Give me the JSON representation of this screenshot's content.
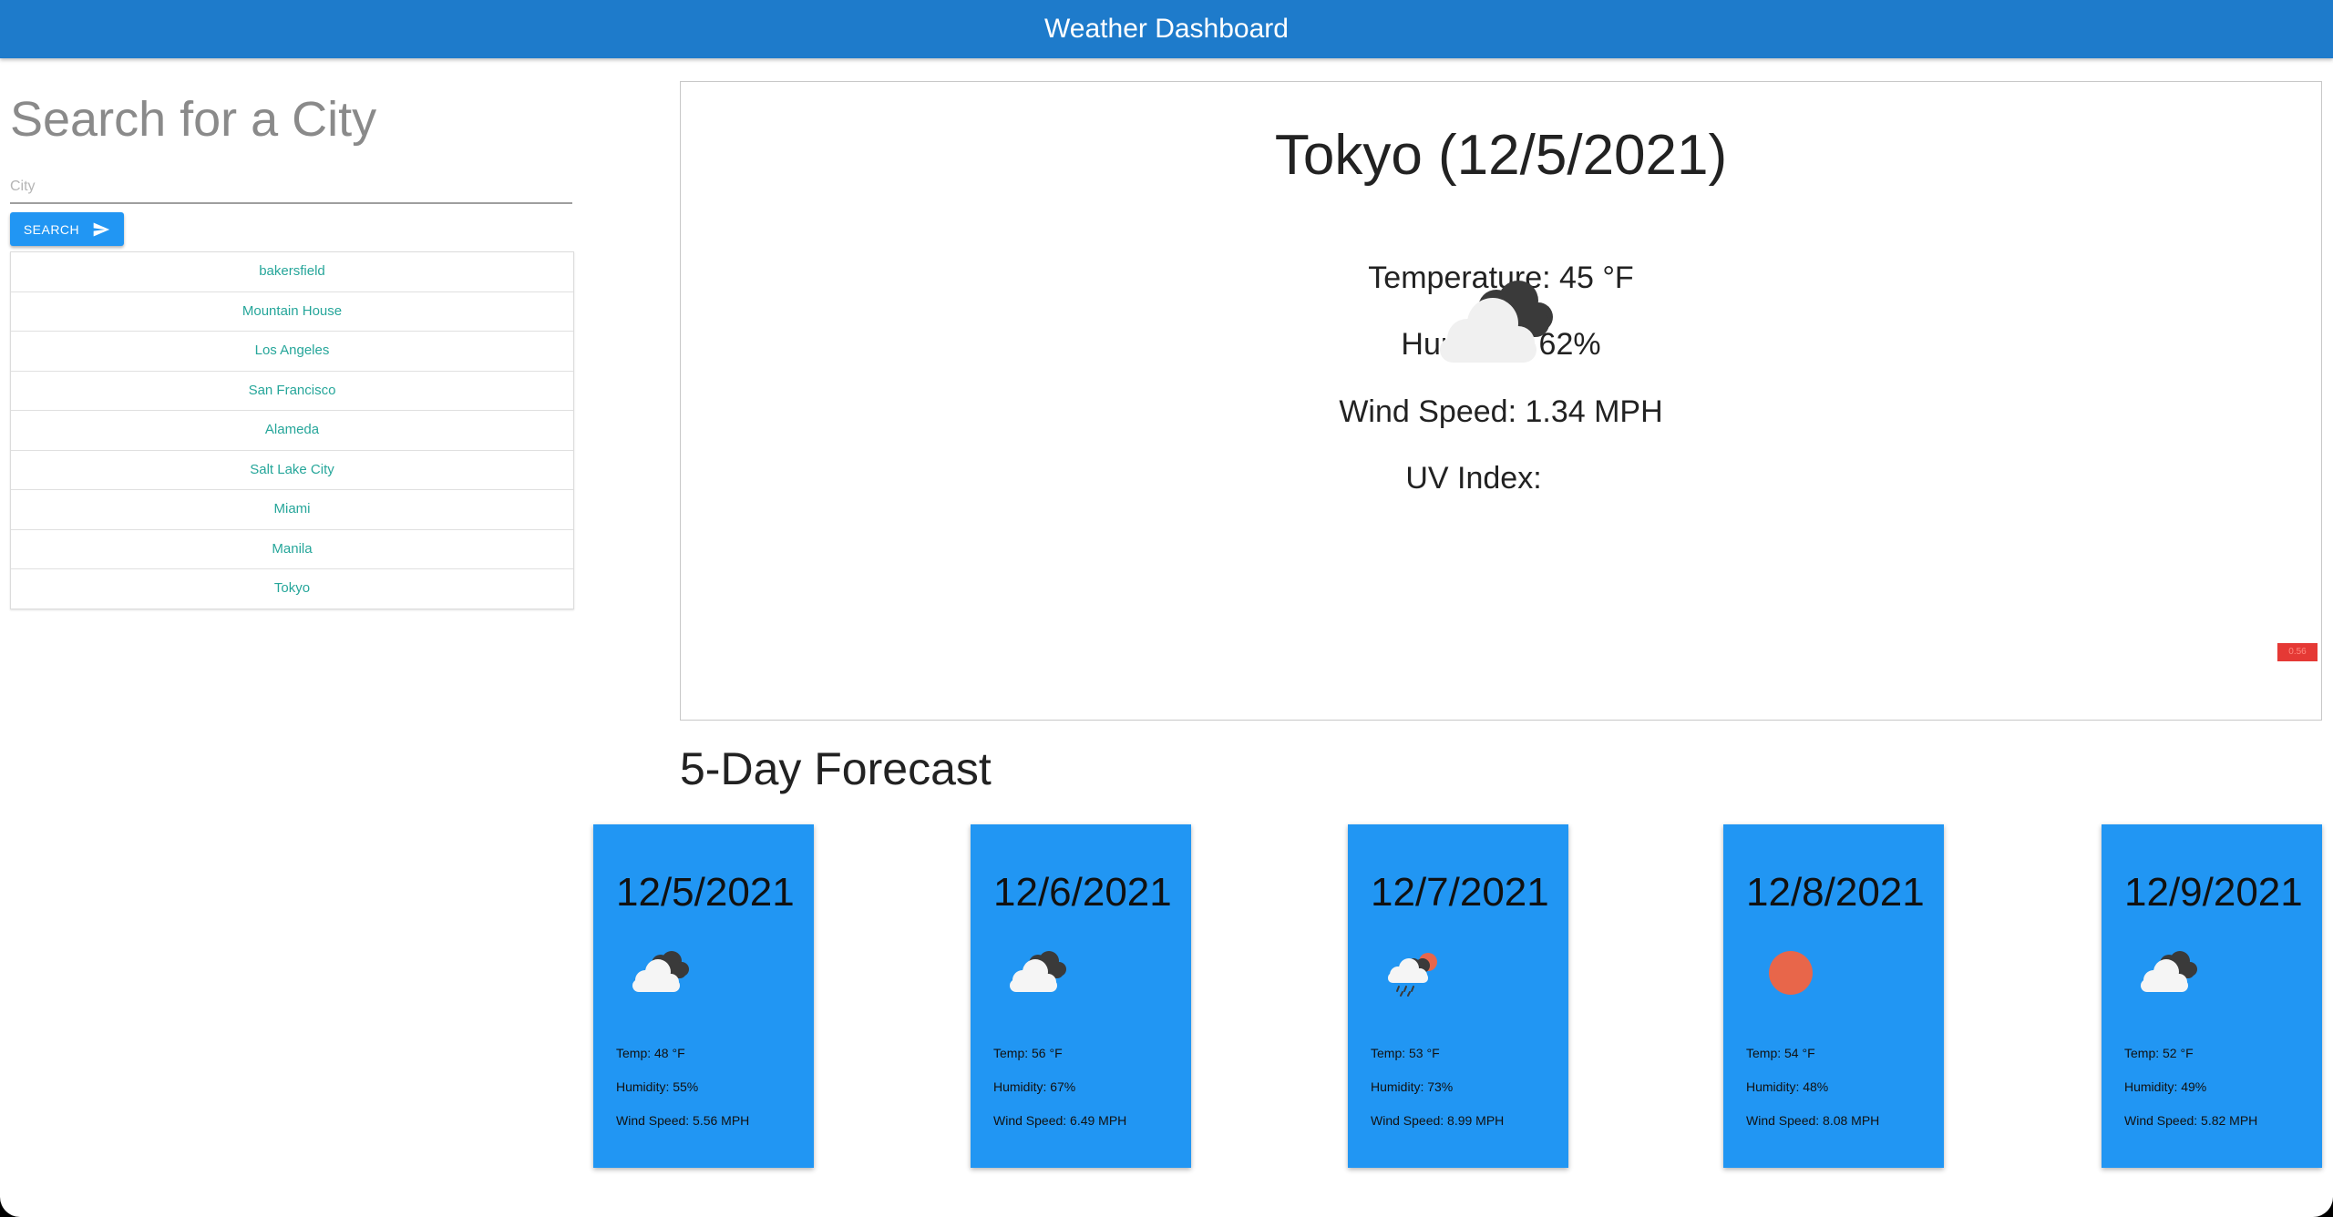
{
  "header": {
    "title": "Weather Dashboard"
  },
  "search": {
    "title": "Search for a City",
    "placeholder": "City",
    "button_label": "SEARCH",
    "button_icon": "send-icon"
  },
  "history": [
    "bakersfield",
    "Mountain House",
    "Los Angeles",
    "San Francisco",
    "Alameda",
    "Salt Lake City",
    "Miami",
    "Manila",
    "Tokyo"
  ],
  "current": {
    "title": "Tokyo (12/5/2021)",
    "icon": "broken-clouds-icon",
    "temperature": "Temperature: 45 °F",
    "humidity": "Humidity: 62%",
    "wind": "Wind Speed: 1.34 MPH",
    "uv_label": "UV Index:",
    "uv_value": "0.56",
    "uv_color": "#e53935"
  },
  "forecast": {
    "heading": "5-Day Forecast",
    "days": [
      {
        "date": "12/5/2021",
        "icon": "broken-clouds-icon",
        "temp": "Temp: 48 °F",
        "humidity": "Humidity: 55%",
        "wind": "Wind Speed: 5.56 MPH"
      },
      {
        "date": "12/6/2021",
        "icon": "broken-clouds-icon",
        "temp": "Temp: 56 °F",
        "humidity": "Humidity: 67%",
        "wind": "Wind Speed: 6.49 MPH"
      },
      {
        "date": "12/7/2021",
        "icon": "rain-icon",
        "temp": "Temp: 53 °F",
        "humidity": "Humidity: 73%",
        "wind": "Wind Speed: 8.99 MPH"
      },
      {
        "date": "12/8/2021",
        "icon": "sun-icon",
        "temp": "Temp: 54 °F",
        "humidity": "Humidity: 48%",
        "wind": "Wind Speed: 8.08 MPH"
      },
      {
        "date": "12/9/2021",
        "icon": "broken-clouds-icon",
        "temp": "Temp: 52 °F",
        "humidity": "Humidity: 49%",
        "wind": "Wind Speed: 5.82 MPH"
      }
    ]
  },
  "colors": {
    "header": "#1e7bcb",
    "accent": "#2196f3",
    "link": "#26a69a",
    "uv_badge": "#e53935"
  }
}
